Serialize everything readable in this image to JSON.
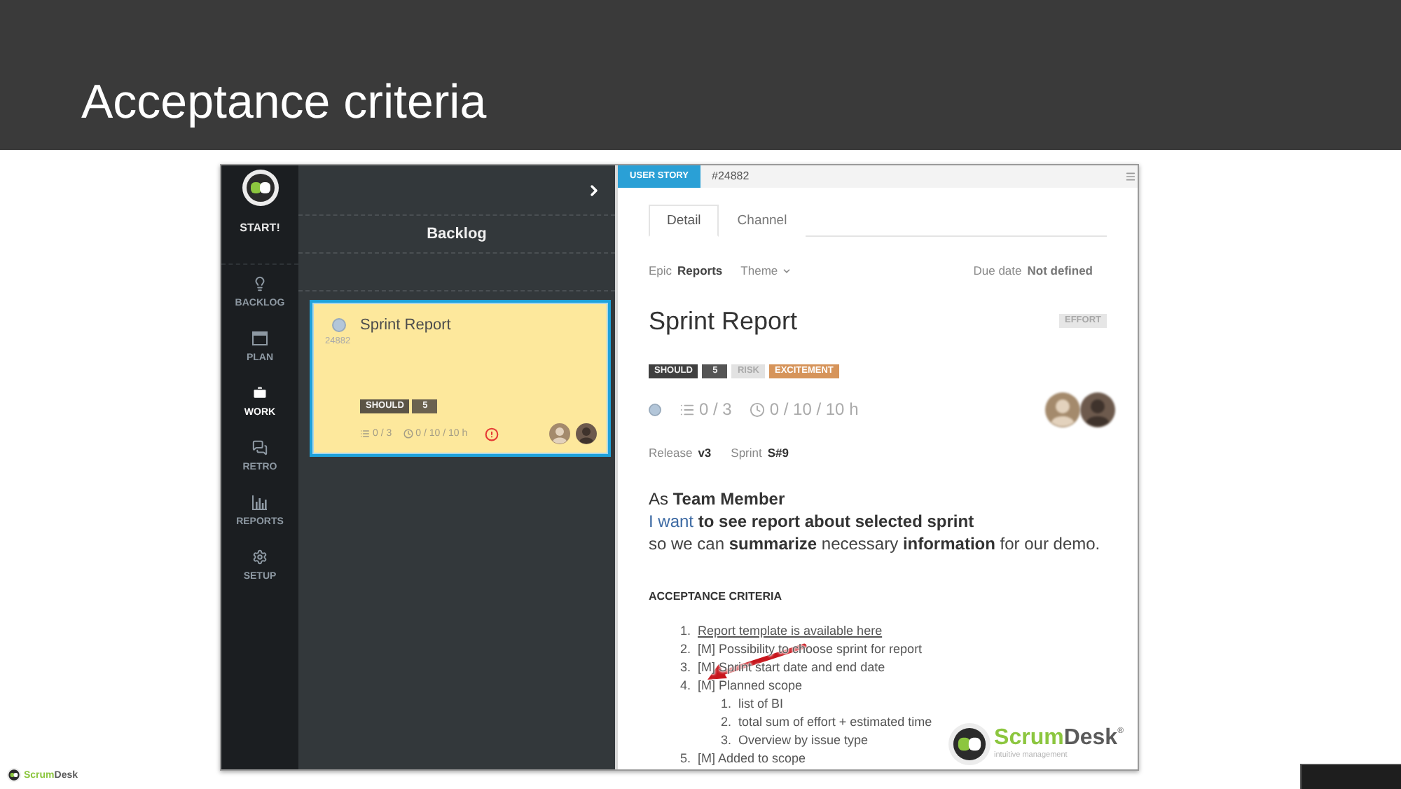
{
  "slide": {
    "title": "Acceptance criteria"
  },
  "nav": {
    "logo_label": "START!",
    "items": [
      {
        "label": "BACKLOG",
        "selected": false
      },
      {
        "label": "PLAN",
        "selected": false
      },
      {
        "label": "WORK",
        "selected": true
      },
      {
        "label": "RETRO",
        "selected": false
      },
      {
        "label": "REPORTS",
        "selected": false
      },
      {
        "label": "SETUP",
        "selected": false
      }
    ]
  },
  "backlog": {
    "title": "Backlog",
    "cards": [
      {
        "title": "Sprint Report",
        "id": "24882",
        "selected": true,
        "tags": [
          {
            "label": "SHOULD",
            "kind": "priority"
          },
          {
            "label": "5",
            "kind": "points"
          }
        ],
        "tasks": "0 / 3",
        "time": "0 / 10 / 10 h",
        "alert": true
      }
    ]
  },
  "detail": {
    "type_label": "USER STORY",
    "number": "#24882",
    "tabs": [
      {
        "label": "Detail",
        "selected": true
      },
      {
        "label": "Channel",
        "selected": false
      }
    ],
    "epic_label": "Epic",
    "epic": "Reports",
    "theme": "Theme",
    "due_label": "Due date",
    "due": "Not defined",
    "title": "Sprint Report",
    "effort": "EFFORT",
    "tags": [
      {
        "label": "SHOULD",
        "kind": "priority"
      },
      {
        "label": "5",
        "kind": "points"
      },
      {
        "label": "RISK",
        "kind": "risk"
      },
      {
        "label": "EXCITEMENT",
        "kind": "excitement"
      }
    ],
    "tasks": "0 / 3",
    "time": "0 / 10 / 10 h",
    "release_label": "Release",
    "release": "v3",
    "sprint_label": "Sprint",
    "sprint": "S#9",
    "story": [
      {
        "text": "As **Team Member**",
        "color": "#333333"
      },
      {
        "text": "I want **to see report about selected sprint**",
        "color": "#3d6aa3"
      },
      {
        "text": "so we can **summarize** necessary **information** for our demo.",
        "color": "#444444"
      }
    ],
    "criteria_title": "ACCEPTANCE CRITERIA",
    "criteria": [
      {
        "number": "1.",
        "text": "Report template is available here",
        "kind": "link"
      },
      {
        "number": "2.",
        "text": "[M] Possibility to choose sprint for report",
        "kind": "text"
      },
      {
        "number": "3.",
        "text": "[M] Sprint start date and end date",
        "kind": "text"
      },
      {
        "number": "4.",
        "text": "[M] Planned scope",
        "kind": "text",
        "children": [
          {
            "number": "1.",
            "text": "list of BI",
            "kind": "text"
          },
          {
            "number": "2.",
            "text": "total sum of effort + estimated time",
            "kind": "text"
          },
          {
            "number": "3.",
            "text": "Overview by issue type",
            "kind": "text"
          }
        ]
      },
      {
        "number": "5.",
        "text": "[M] Added to scope",
        "kind": "text"
      }
    ]
  },
  "logo": {
    "brand_first": "Scrum",
    "brand_second": "Desk",
    "mark": "®",
    "tagline": "intuitive management"
  },
  "footer": {
    "brand_first": "Scrum",
    "brand_second": "Desk"
  }
}
